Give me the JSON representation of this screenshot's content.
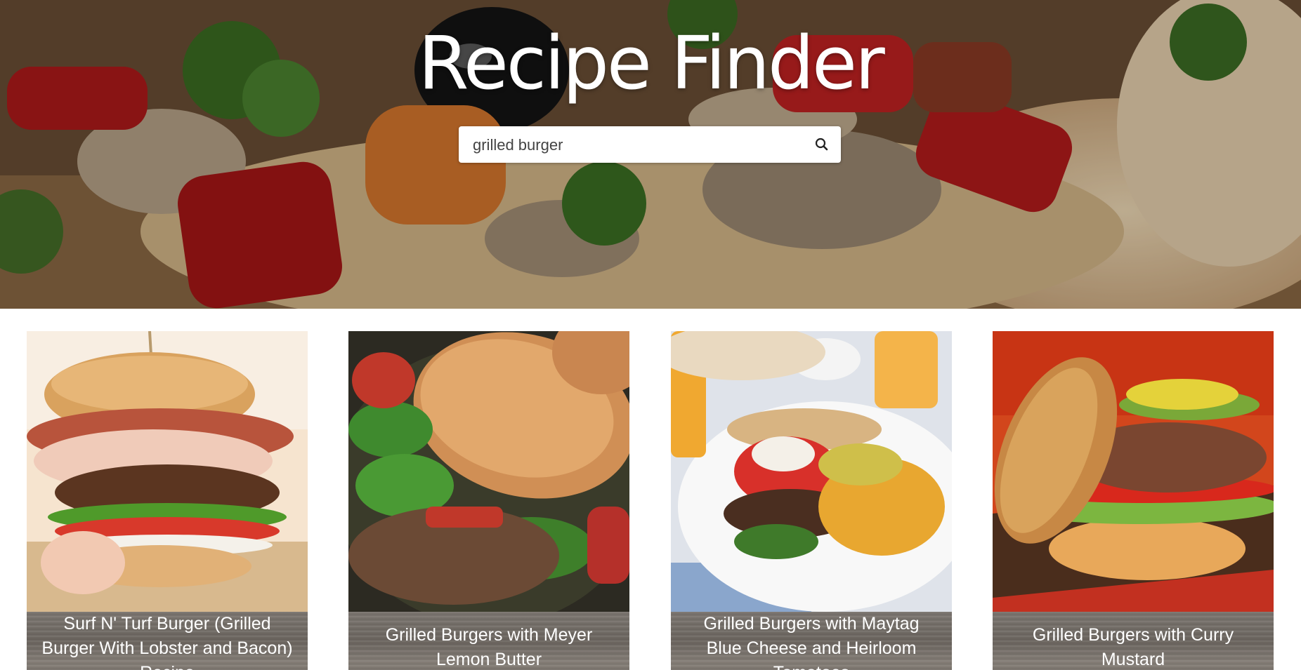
{
  "header": {
    "title": "Recipe Finder"
  },
  "search": {
    "value": "grilled burger",
    "icon": "search-icon"
  },
  "recipes": [
    {
      "title": "Surf N' Turf Burger (Grilled Burger With Lobster and Bacon) Recipe"
    },
    {
      "title": "Grilled Burgers with Meyer Lemon Butter"
    },
    {
      "title": "Grilled Burgers with Maytag Blue Cheese and Heirloom Tomatoes"
    },
    {
      "title": "Grilled Burgers with Curry Mustard"
    }
  ],
  "colors": {
    "caption_wood": "#766f69",
    "title_text": "#ffffff"
  }
}
